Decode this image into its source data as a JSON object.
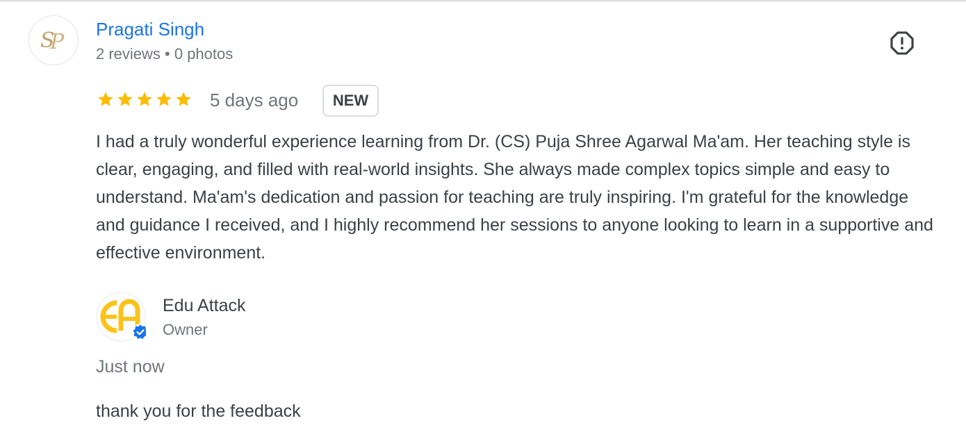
{
  "review": {
    "reviewer_name": "Pragati Singh",
    "reviewer_meta": "2 reviews • 0 photos",
    "avatar_letters": "SP",
    "rating": 5,
    "date": "5 days ago",
    "badge": "NEW",
    "text": "I had a truly wonderful experience learning from Dr. (CS) Puja Shree Agarwal Ma'am. Her teaching style is clear, engaging, and filled with real-world insights. She always made complex topics simple and easy to understand. Ma'am's dedication and passion for teaching are truly inspiring. I'm grateful for the knowledge and guidance I received, and I highly recommend her sessions to anyone looking to learn in a supportive and effective environment."
  },
  "owner_reply": {
    "owner_name": "Edu Attack",
    "owner_role": "Owner",
    "logo_letters": "EA",
    "time": "Just now",
    "text": "thank you for the feedback"
  },
  "icons": {
    "report": "report-flag-icon",
    "star": "star-icon",
    "verified": "verified-badge-icon"
  },
  "colors": {
    "name_link": "#1a73e8",
    "star": "#fbbc04",
    "verified": "#1a73e8",
    "logo_yellow": "#f9c31b"
  }
}
